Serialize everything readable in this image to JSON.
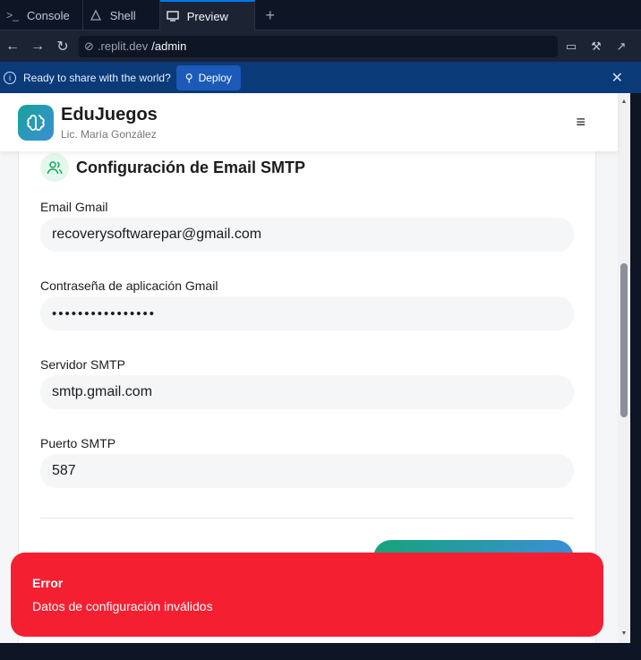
{
  "tabs": [
    {
      "label": "Console",
      "icon": "terminal-icon"
    },
    {
      "label": "Shell",
      "icon": "shell-icon"
    },
    {
      "label": "Preview",
      "icon": "monitor-icon"
    }
  ],
  "url": {
    "host": ".replit.dev",
    "path": "/admin"
  },
  "banner": {
    "text": "Ready to share with the world?",
    "deploy_label": "Deploy"
  },
  "app": {
    "brand_title": "EduJuegos",
    "brand_subtitle": "Lic. María González"
  },
  "smtp": {
    "title": "Configuración de Email SMTP",
    "email_label": "Email Gmail",
    "email_value": "recoverysoftwarepar@gmail.com",
    "password_label": "Contraseña de aplicación Gmail",
    "password_value": "••••••••••••••••",
    "server_label": "Servidor SMTP",
    "server_value": "smtp.gmail.com",
    "port_label": "Puerto SMTP",
    "port_value": "587"
  },
  "toast": {
    "title": "Error",
    "message": "Datos de configuración inválidos"
  },
  "colors": {
    "accent": "#0079f2",
    "error": "#f42032",
    "brand_teal": "#16a39a"
  }
}
